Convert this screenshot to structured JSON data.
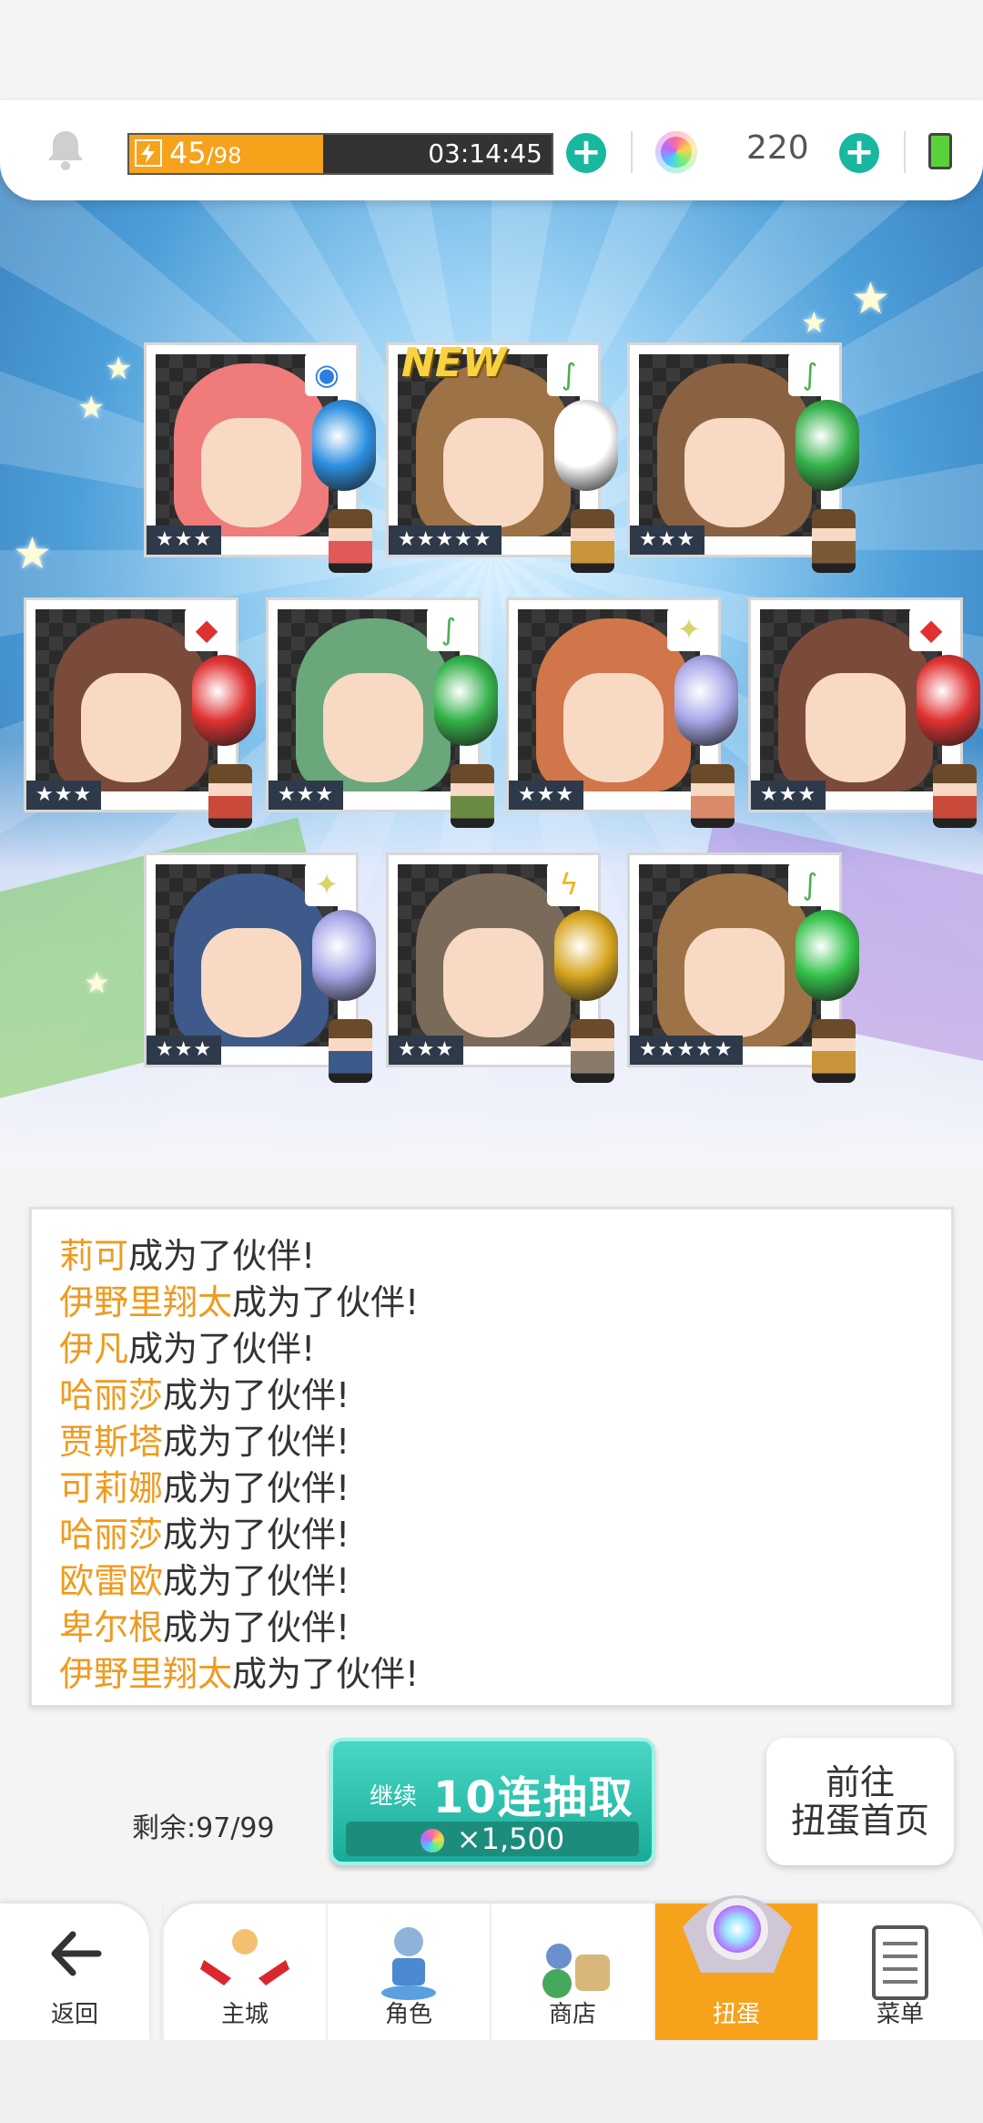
{
  "status": {
    "stamina_current": "45",
    "stamina_max": "/98",
    "stamina_fraction": 0.459,
    "timer": "03:14:45",
    "gems": "220"
  },
  "cards": [
    {
      "rarity": "★★★",
      "element": "◉",
      "element_color": "#2d7ee0",
      "badge_color": "#2d8fe0",
      "sprite_color": "#e05a5a",
      "new": false,
      "bg": "#f07b7b"
    },
    {
      "rarity": "★★★★★",
      "element": "∫",
      "element_color": "#4caf50",
      "badge_color": "#ffffff",
      "sprite_color": "#c9953b",
      "new": true,
      "new_label": "NEW",
      "bg": "#9c7246"
    },
    {
      "rarity": "★★★",
      "element": "∫",
      "element_color": "#4caf50",
      "badge_color": "#35b24a",
      "sprite_color": "#7a5a34",
      "new": false,
      "bg": "#8a6242"
    },
    {
      "rarity": "★★★",
      "element": "◆",
      "element_color": "#e03030",
      "badge_color": "#e03232",
      "sprite_color": "#c94a3a",
      "new": false,
      "bg": "#7a4a3a"
    },
    {
      "rarity": "★★★",
      "element": "∫",
      "element_color": "#4caf50",
      "badge_color": "#35b24a",
      "sprite_color": "#6a8a44",
      "new": false,
      "bg": "#6aa77a"
    },
    {
      "rarity": "★★★",
      "element": "✦",
      "element_color": "#d9d36a",
      "badge_color": "#a8a8e8",
      "sprite_color": "#d88a6a",
      "new": false,
      "bg": "#d0764a"
    },
    {
      "rarity": "★★★",
      "element": "◆",
      "element_color": "#e03030",
      "badge_color": "#e03232",
      "sprite_color": "#c94a3a",
      "new": false,
      "bg": "#7a4a3a"
    },
    {
      "rarity": "★★★",
      "element": "✦",
      "element_color": "#d9d36a",
      "badge_color": "#a8a8e8",
      "sprite_color": "#3a5a8a",
      "new": false,
      "bg": "#3d5a8a"
    },
    {
      "rarity": "★★★",
      "element": "ϟ",
      "element_color": "#f2b31c",
      "badge_color": "#d6a620",
      "sprite_color": "#8a7a6a",
      "new": false,
      "bg": "#7a6a5a"
    },
    {
      "rarity": "★★★★★",
      "element": "∫",
      "element_color": "#4caf50",
      "badge_color": "#35c24a",
      "sprite_color": "#c9953b",
      "new": false,
      "bg": "#9c7246"
    }
  ],
  "log": [
    {
      "name": "莉可",
      "suffix": "成为了伙伴!"
    },
    {
      "name": "伊野里翔太",
      "suffix": "成为了伙伴!"
    },
    {
      "name": "伊凡",
      "suffix": "成为了伙伴!"
    },
    {
      "name": "哈丽莎",
      "suffix": "成为了伙伴!"
    },
    {
      "name": "贾斯塔",
      "suffix": "成为了伙伴!"
    },
    {
      "name": "可莉娜",
      "suffix": "成为了伙伴!"
    },
    {
      "name": "哈丽莎",
      "suffix": "成为了伙伴!"
    },
    {
      "name": "欧雷欧",
      "suffix": "成为了伙伴!"
    },
    {
      "name": "卑尔根",
      "suffix": "成为了伙伴!"
    },
    {
      "name": "伊野里翔太",
      "suffix": "成为了伙伴!"
    }
  ],
  "remaining": "剩余:97/99",
  "draw_button": {
    "continue_label": "继续",
    "main_label": "10连抽取",
    "cost": "×1,500"
  },
  "home_button": {
    "line1": "前往",
    "line2": "扭蛋首页"
  },
  "nav": {
    "back": "返回",
    "tabs": [
      {
        "label": "主城",
        "icon": "castle-icon",
        "active": false
      },
      {
        "label": "角色",
        "icon": "character-icon",
        "active": false
      },
      {
        "label": "商店",
        "icon": "shop-icon",
        "active": false
      },
      {
        "label": "扭蛋",
        "icon": "gacha-icon",
        "active": true
      },
      {
        "label": "菜单",
        "icon": "menu-icon",
        "active": false
      }
    ]
  },
  "colors": {
    "accent": "#f7a21b",
    "teal": "#18b7a0",
    "name_highlight": "#f09a1e"
  }
}
